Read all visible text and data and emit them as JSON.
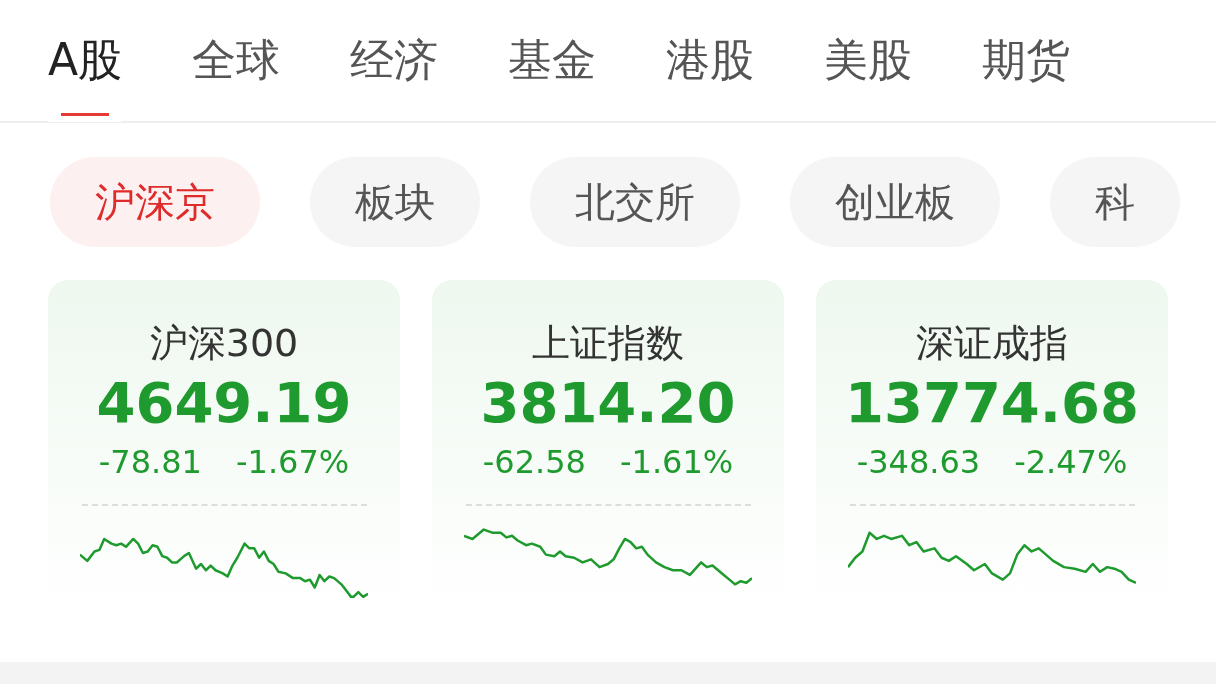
{
  "tabs": [
    {
      "label": "A股",
      "selected": true
    },
    {
      "label": "全球",
      "selected": false
    },
    {
      "label": "经济",
      "selected": false
    },
    {
      "label": "基金",
      "selected": false
    },
    {
      "label": "港股",
      "selected": false
    },
    {
      "label": "美股",
      "selected": false
    },
    {
      "label": "期货",
      "selected": false
    }
  ],
  "chips": [
    {
      "label": "沪深京",
      "selected": true
    },
    {
      "label": "板块",
      "selected": false
    },
    {
      "label": "北交所",
      "selected": false
    },
    {
      "label": "创业板",
      "selected": false
    },
    {
      "label": "科",
      "selected": false
    }
  ],
  "indices": [
    {
      "name": "沪深300",
      "value": "4649.19",
      "change": "-78.81",
      "percent": "-1.67%"
    },
    {
      "name": "上证指数",
      "value": "3814.20",
      "change": "-62.58",
      "percent": "-1.61%"
    },
    {
      "name": "深证成指",
      "value": "13774.68",
      "change": "-348.63",
      "percent": "-2.47%"
    }
  ]
}
